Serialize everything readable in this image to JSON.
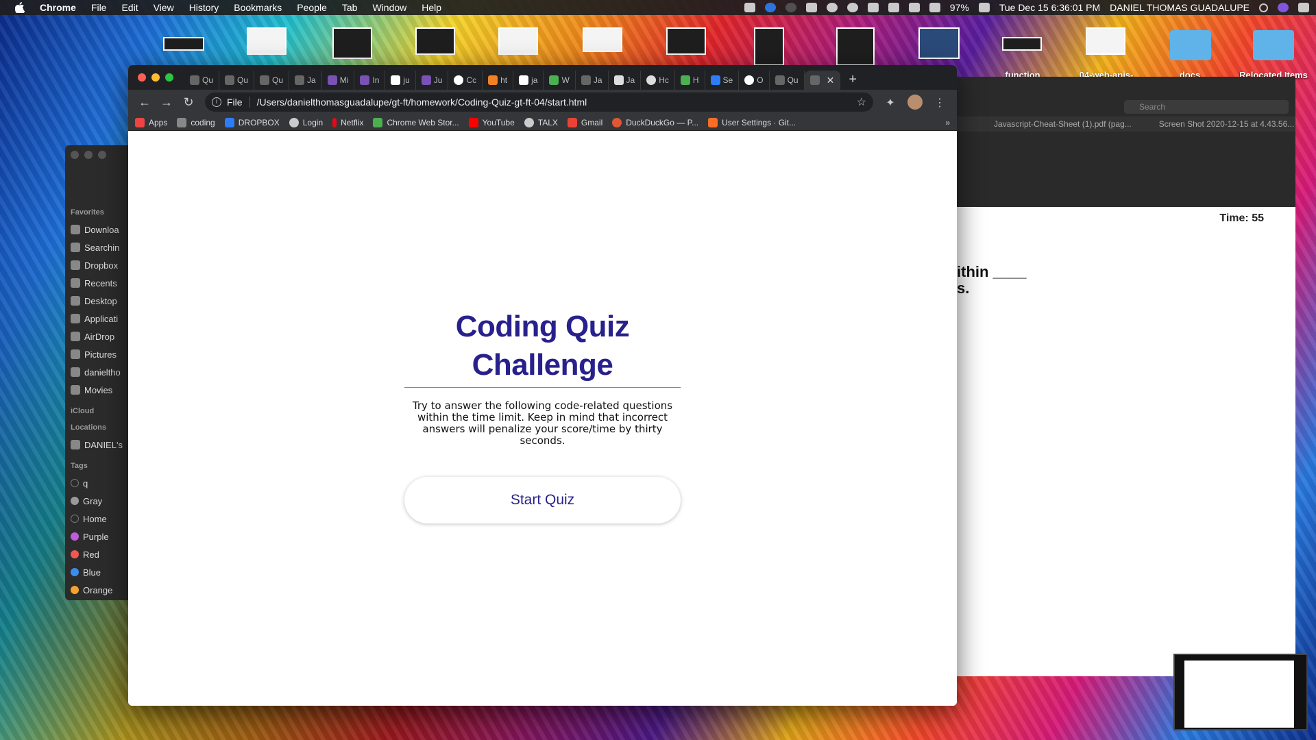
{
  "menubar": {
    "app": "Chrome",
    "items": [
      "File",
      "Edit",
      "View",
      "History",
      "Bookmarks",
      "People",
      "Tab",
      "Window",
      "Help"
    ],
    "battery": "97%",
    "datetime": "Tue Dec 15  6:36:01 PM",
    "user": "DANIEL THOMAS GUADALUPE"
  },
  "desktop": {
    "thumb_labels": [
      "function",
      "04-web-apis-",
      "docs",
      "Relocated Items"
    ]
  },
  "finder": {
    "favorites_label": "Favorites",
    "favorites": [
      "Downloa",
      "Searchin",
      "Dropbox",
      "Recents",
      "Desktop",
      "Applicati",
      "AirDrop",
      "Pictures",
      "danieltho",
      "Movies"
    ],
    "icloud_label": "iCloud",
    "locations_label": "Locations",
    "locations": [
      "DANIEL's"
    ],
    "tags_label": "Tags",
    "tags": [
      {
        "name": "q",
        "color": "#444444"
      },
      {
        "name": "Gray",
        "color": "#9a9a9a"
      },
      {
        "name": "Home",
        "color": "#444444"
      },
      {
        "name": "Purple",
        "color": "#c05cdc"
      },
      {
        "name": "Red",
        "color": "#f0584f"
      },
      {
        "name": "Blue",
        "color": "#3a8df0"
      },
      {
        "name": "Orange",
        "color": "#f4a32c"
      }
    ]
  },
  "bgwindow": {
    "timer": "Time: 55",
    "fragment1": "ithin ____",
    "fragment2": "s.",
    "tab1": "Javascript-Cheat-Sheet (1).pdf (pag...",
    "tab2": "Screen Shot 2020-12-15 at 4.43.56...",
    "search_placeholder": "Search"
  },
  "chrome": {
    "tabs": [
      {
        "label": "Qu"
      },
      {
        "label": "Qu"
      },
      {
        "label": "Qu"
      },
      {
        "label": "Ja"
      },
      {
        "label": "Mi"
      },
      {
        "label": "In"
      },
      {
        "label": "ju"
      },
      {
        "label": "Ju"
      },
      {
        "label": "Cc"
      },
      {
        "label": "ht"
      },
      {
        "label": "ja"
      },
      {
        "label": "W"
      },
      {
        "label": "Ja"
      },
      {
        "label": "Ja"
      },
      {
        "label": "Hc"
      },
      {
        "label": "H"
      },
      {
        "label": "Se"
      },
      {
        "label": "O"
      },
      {
        "label": "Qu"
      }
    ],
    "url_scheme": "File",
    "url": "/Users/danielthomasguadalupe/gt-ft/homework/Coding-Quiz-gt-ft-04/start.html",
    "bookmarks": [
      {
        "label": "Apps",
        "color": "#e44"
      },
      {
        "label": "coding",
        "color": "#888"
      },
      {
        "label": "DROPBOX",
        "color": "#2d7df6"
      },
      {
        "label": "Login",
        "color": "#ccc"
      },
      {
        "label": "Netflix",
        "color": "#e50914"
      },
      {
        "label": "Chrome Web Stor...",
        "color": "#4caf50"
      },
      {
        "label": "YouTube",
        "color": "#ff0000"
      },
      {
        "label": "TALX",
        "color": "#ccc"
      },
      {
        "label": "Gmail",
        "color": "#ea4335"
      },
      {
        "label": "DuckDuckGo — P...",
        "color": "#de5833"
      },
      {
        "label": "User Settings · Git...",
        "color": "#fc6d26"
      }
    ]
  },
  "quiz": {
    "title": "Coding Quiz Challenge",
    "description": "Try to answer the following code-related questions within the time limit. Keep in mind that incorrect answers will penalize your score/time by thirty seconds.",
    "start_button": "Start Quiz",
    "accent_color": "#28208c"
  }
}
